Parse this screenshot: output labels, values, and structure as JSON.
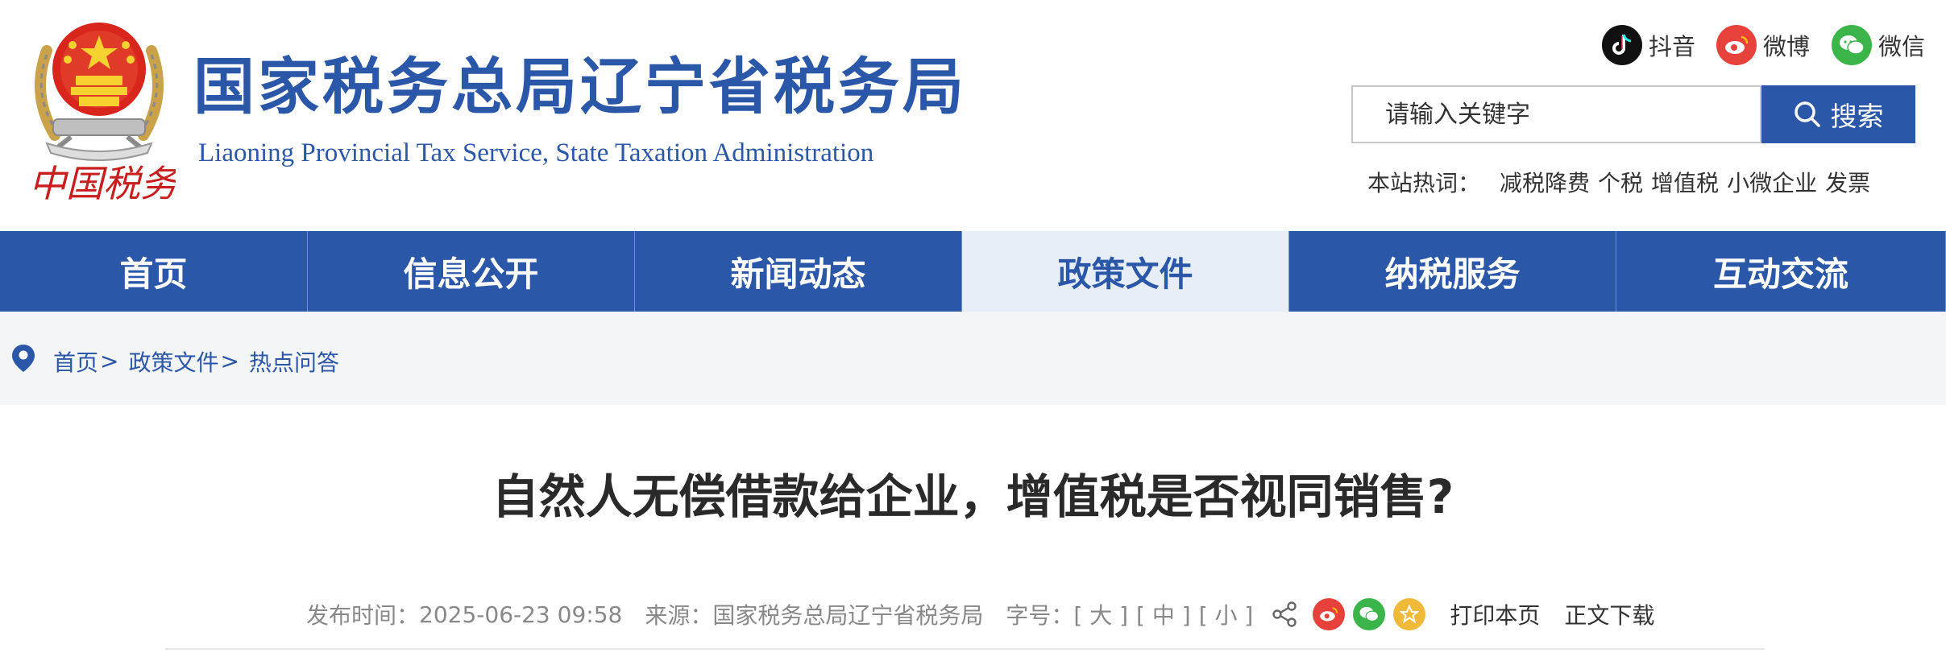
{
  "header": {
    "title": "国家税务总局辽宁省税务局",
    "subtitle": "Liaoning Provincial Tax Service, State Taxation Administration",
    "logo_text": "中国税务",
    "social": [
      {
        "label": "抖音",
        "icon": "douyin-icon",
        "color": "#111111"
      },
      {
        "label": "微博",
        "icon": "weibo-icon",
        "color": "#e6413b"
      },
      {
        "label": "微信",
        "icon": "wechat-icon",
        "color": "#3bb54a"
      }
    ]
  },
  "search": {
    "placeholder": "请输入关键字",
    "button_label": "搜索",
    "hot_label": "本站热词：",
    "hot_words": [
      "减税降费",
      "个税",
      "增值税",
      "小微企业",
      "发票"
    ]
  },
  "nav": {
    "items": [
      "首页",
      "信息公开",
      "新闻动态",
      "政策文件",
      "纳税服务",
      "互动交流"
    ],
    "active": "政策文件"
  },
  "breadcrumb": [
    "首页",
    "政策文件",
    "热点问答"
  ],
  "article": {
    "title": "自然人无偿借款给企业，增值税是否视同销售?",
    "publish_label": "发布时间：",
    "publish_time": "2025-06-23 09:58",
    "source_label": "来源：",
    "source": "国家税务总局辽宁省税务局",
    "font_label": "字号：",
    "font_sizes": [
      "[ 大 ]",
      "[ 中 ]",
      "[ 小 ]"
    ],
    "print_label": "打印本页",
    "download_label": "正文下载"
  },
  "colors": {
    "brand": "#2b57a8",
    "nav_active_bg": "#e8eef7",
    "breadcrumb_bg": "#f4f5f7"
  }
}
